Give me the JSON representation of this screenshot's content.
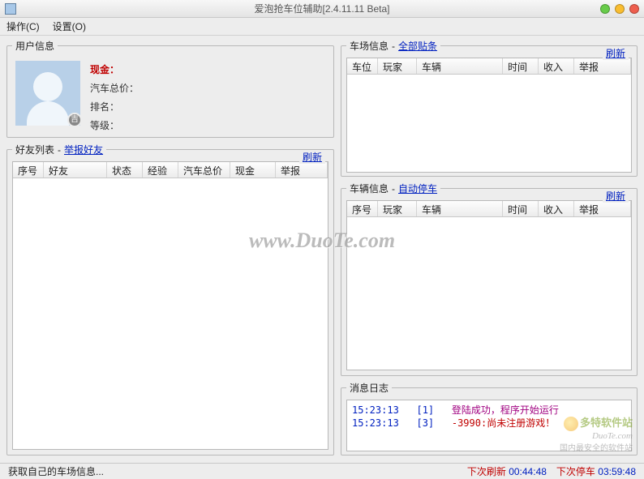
{
  "title": "爱泡抢车位辅助[2.4.11.11 Beta]",
  "menu": {
    "operate": "操作(C)",
    "settings": "设置(O)"
  },
  "user_info": {
    "legend": "用户信息",
    "cash_label": "现金：",
    "car_total_label": "汽车总价：",
    "rank_label": "排名：",
    "level_label": "等级："
  },
  "friend_list": {
    "legend": "好友列表",
    "report_link": "举报好友",
    "refresh": "刷新",
    "columns": [
      "序号",
      "好友",
      "状态",
      "经验",
      "汽车总价",
      "现金",
      "举报"
    ]
  },
  "parking_info": {
    "legend": "车场信息",
    "all_posts_link": "全部贴条",
    "refresh": "刷新",
    "columns": [
      "车位",
      "玩家",
      "车辆",
      "时间",
      "收入",
      "举报"
    ]
  },
  "vehicle_info": {
    "legend": "车辆信息",
    "auto_park_link": "自动停车",
    "refresh": "刷新",
    "columns": [
      "序号",
      "玩家",
      "车辆",
      "时间",
      "收入",
      "举报"
    ]
  },
  "log": {
    "legend": "消息日志",
    "entries": [
      {
        "time": "15:23:13",
        "code": "[1]",
        "message": "登陆成功，程序开始运行",
        "cls": "log-msg-normal"
      },
      {
        "time": "15:23:13",
        "code": "[3]",
        "message": "-3990:尚未注册游戏！",
        "cls": "log-msg-error"
      }
    ]
  },
  "status": {
    "left": "获取自己的车场信息...",
    "next_refresh_label": "下次刷新",
    "next_refresh_time": "00:44:48",
    "next_park_label": "下次停车",
    "next_park_time": "03:59:48"
  },
  "watermark": "www.DuoTe.com",
  "brand": {
    "cn": "多特软件站",
    "en": "DuoTe.com",
    "sub": "国内最安全的软件站"
  }
}
